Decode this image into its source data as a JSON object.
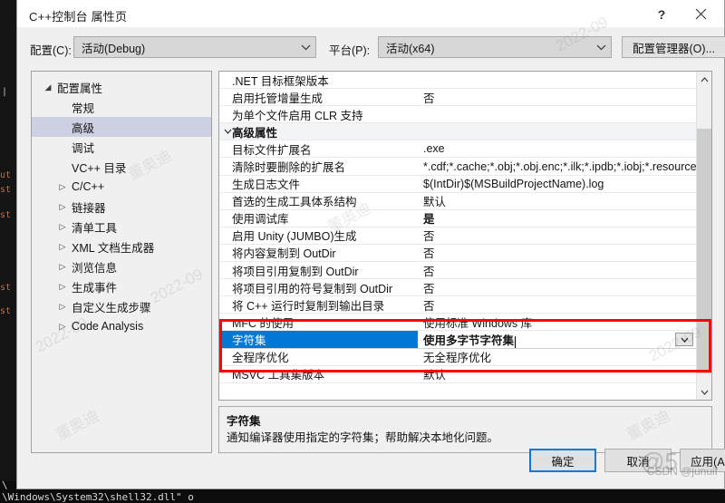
{
  "window": {
    "title": "C++控制台 属性页",
    "help_icon": "?",
    "close_icon": "✕"
  },
  "config_bar": {
    "config_label": "配置(C):",
    "config_value": "活动(Debug)",
    "platform_label": "平台(P):",
    "platform_value": "活动(x64)",
    "config_manager_button": "配置管理器(O)...",
    "chevron_icon": "⌄"
  },
  "tree": {
    "items": [
      {
        "label": "配置属性",
        "depth": 0,
        "twisty": "◢",
        "selected": false
      },
      {
        "label": "常规",
        "depth": 1,
        "twisty": "",
        "selected": false
      },
      {
        "label": "高级",
        "depth": 1,
        "twisty": "",
        "selected": true
      },
      {
        "label": "调试",
        "depth": 1,
        "twisty": "",
        "selected": false
      },
      {
        "label": "VC++ 目录",
        "depth": 1,
        "twisty": "",
        "selected": false
      },
      {
        "label": "C/C++",
        "depth": 1,
        "twisty": "▷",
        "selected": false
      },
      {
        "label": "链接器",
        "depth": 1,
        "twisty": "▷",
        "selected": false
      },
      {
        "label": "清单工具",
        "depth": 1,
        "twisty": "▷",
        "selected": false
      },
      {
        "label": "XML 文档生成器",
        "depth": 1,
        "twisty": "▷",
        "selected": false
      },
      {
        "label": "浏览信息",
        "depth": 1,
        "twisty": "▷",
        "selected": false
      },
      {
        "label": "生成事件",
        "depth": 1,
        "twisty": "▷",
        "selected": false
      },
      {
        "label": "自定义生成步骤",
        "depth": 1,
        "twisty": "▷",
        "selected": false
      },
      {
        "label": "Code Analysis",
        "depth": 1,
        "twisty": "▷",
        "selected": false
      }
    ]
  },
  "grid": {
    "rows": [
      {
        "name": ".NET 目标框架版本",
        "value": "",
        "group": false,
        "bold_value": false,
        "selected": false,
        "twisty": ""
      },
      {
        "name": "启用托管增量生成",
        "value": "否",
        "group": false,
        "bold_value": false,
        "selected": false,
        "twisty": ""
      },
      {
        "name": "为单个文件启用 CLR 支持",
        "value": "",
        "group": false,
        "bold_value": false,
        "selected": false,
        "twisty": ""
      },
      {
        "name": "高级属性",
        "value": "",
        "group": true,
        "bold_value": false,
        "selected": false,
        "twisty": "⌄"
      },
      {
        "name": "目标文件扩展名",
        "value": ".exe",
        "group": false,
        "bold_value": false,
        "selected": false,
        "twisty": ""
      },
      {
        "name": "清除时要删除的扩展名",
        "value": "*.cdf;*.cache;*.obj;*.obj.enc;*.ilk;*.ipdb;*.iobj;*.resource",
        "group": false,
        "bold_value": false,
        "selected": false,
        "twisty": ""
      },
      {
        "name": "生成日志文件",
        "value": "$(IntDir)$(MSBuildProjectName).log",
        "group": false,
        "bold_value": false,
        "selected": false,
        "twisty": ""
      },
      {
        "name": "首选的生成工具体系结构",
        "value": "默认",
        "group": false,
        "bold_value": false,
        "selected": false,
        "twisty": ""
      },
      {
        "name": "使用调试库",
        "value": "是",
        "group": false,
        "bold_value": true,
        "selected": false,
        "twisty": ""
      },
      {
        "name": "启用 Unity (JUMBO)生成",
        "value": "否",
        "group": false,
        "bold_value": false,
        "selected": false,
        "twisty": ""
      },
      {
        "name": "将内容复制到 OutDir",
        "value": "否",
        "group": false,
        "bold_value": false,
        "selected": false,
        "twisty": ""
      },
      {
        "name": "将项目引用复制到 OutDir",
        "value": "否",
        "group": false,
        "bold_value": false,
        "selected": false,
        "twisty": ""
      },
      {
        "name": "将项目引用的符号复制到 OutDir",
        "value": "否",
        "group": false,
        "bold_value": false,
        "selected": false,
        "twisty": ""
      },
      {
        "name": "将 C++ 运行时复制到输出目录",
        "value": "否",
        "group": false,
        "bold_value": false,
        "selected": false,
        "twisty": ""
      },
      {
        "name": "MFC 的使用",
        "value": "使用标准 Windows 库",
        "group": false,
        "bold_value": false,
        "selected": false,
        "twisty": ""
      },
      {
        "name": "字符集",
        "value": "使用多字节字符集",
        "group": false,
        "bold_value": true,
        "selected": true,
        "twisty": ""
      },
      {
        "name": "全程序优化",
        "value": "无全程序优化",
        "group": false,
        "bold_value": false,
        "selected": false,
        "twisty": ""
      },
      {
        "name": "MSVC 工具集版本",
        "value": "默认",
        "group": false,
        "bold_value": false,
        "selected": false,
        "twisty": ""
      }
    ],
    "scrollbar": {
      "up_icon": "⌃",
      "down_icon": "⌄"
    },
    "inline_dropdown_icon": "⌄"
  },
  "description": {
    "title": "字符集",
    "text": "通知编译器使用指定的字符集；帮助解决本地化问题。"
  },
  "footer": {
    "ok": "确定",
    "cancel": "取消",
    "apply": "应用(A)"
  },
  "backdrop": {
    "console_upper": "\\",
    "console_lower": "\\Windows\\System32\\shell32.dll\" o"
  },
  "watermarks": {
    "date1": "2022-09",
    "date2": "2022-09",
    "date3": "2022-09",
    "date4": "2022-09",
    "author1": "董奥迪",
    "author2": "董奥迪",
    "author3": "董奥迪",
    "author4": "董奥迪",
    "csdn_big": "@5",
    "csdn_small": "CSDN @junuif"
  },
  "colors": {
    "accent": "#0078d7",
    "annotation": "#ff0000",
    "dialog_bg": "#f0f0f0",
    "tree_selection": "#cdd0e0"
  }
}
